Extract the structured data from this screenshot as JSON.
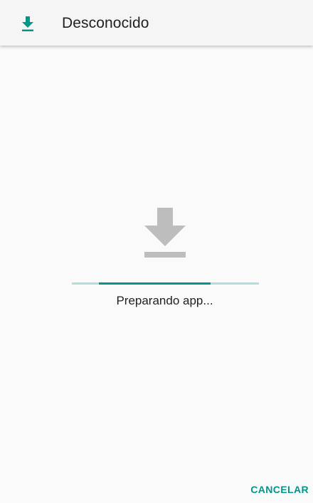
{
  "appbar": {
    "title": "Desconocido",
    "icon": "download-icon"
  },
  "main": {
    "icon": "download-large-icon",
    "status_text": "Preparando app...",
    "progress": {
      "fraction": 0.6,
      "indeterminate": true
    }
  },
  "footer": {
    "cancel_label": "CANCELAR"
  },
  "colors": {
    "accent": "#009688",
    "track": "#b2dfdb",
    "icon_gray": "#bdbdbd",
    "text": "#212121",
    "background": "#fafafa",
    "appbar": "#f5f5f5"
  }
}
